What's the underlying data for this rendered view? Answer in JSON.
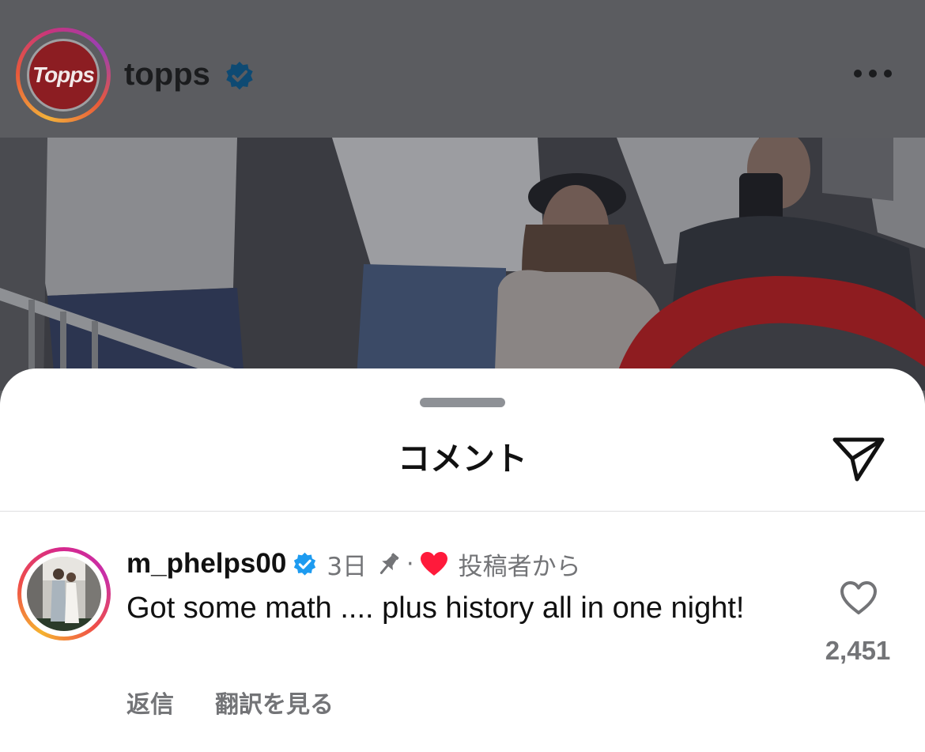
{
  "post_header": {
    "account_name": "topps",
    "logo_text": "Topps",
    "verified_icon": "verified-badge-icon",
    "more_icon": "more-horizontal-icon"
  },
  "sheet": {
    "title": "コメント",
    "share_icon": "paper-plane-icon"
  },
  "comment": {
    "username": "m_phelps00",
    "verified_icon": "verified-badge-icon",
    "time": "3日",
    "pinned_icon": "pin-icon",
    "separator": "·",
    "liked_by_author_icon": "heart-filled-icon",
    "liked_by_author_label": "投稿者から",
    "text": "Got some math .... plus history all in one night!",
    "reply_label": "返信",
    "translate_label": "翻訳を見る",
    "like_icon": "heart-outline-icon",
    "like_count": "2,451"
  },
  "colors": {
    "overlay": "#5b5c60",
    "verified_blue": "#1d9bf0",
    "like_red": "#ff1a3b",
    "secondary_text": "#737477"
  }
}
